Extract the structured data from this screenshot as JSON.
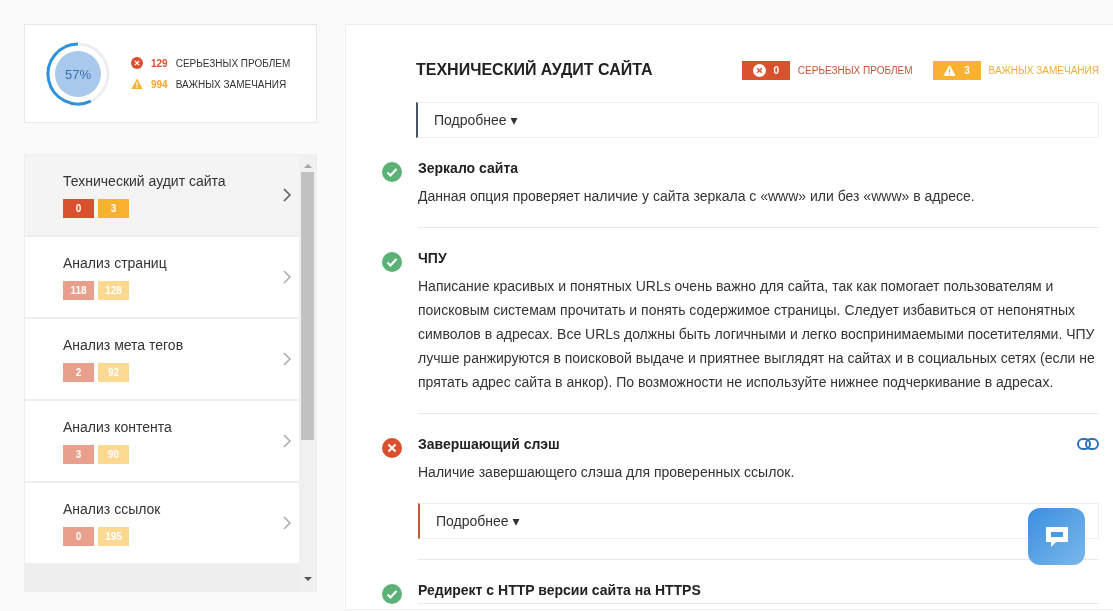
{
  "summary": {
    "score": "57%",
    "level": 0.57,
    "errors": {
      "count": "129",
      "label": "СЕРЬЕЗНЫХ ПРОБЛЕМ"
    },
    "warnings": {
      "count": "994",
      "label": "ВАЖНЫХ ЗАМЕЧАНИЯ"
    }
  },
  "sidebar": {
    "items": [
      {
        "title": "Технический аудит сайта",
        "errors": "0",
        "warnings": "3",
        "selected": true
      },
      {
        "title": "Анализ страниц",
        "errors": "118",
        "warnings": "128",
        "selected": false
      },
      {
        "title": "Анализ мета тегов",
        "errors": "2",
        "warnings": "92",
        "selected": false
      },
      {
        "title": "Анализ контента",
        "errors": "3",
        "warnings": "90",
        "selected": false
      },
      {
        "title": "Анализ ссылок",
        "errors": "0",
        "warnings": "195",
        "selected": false
      }
    ]
  },
  "main": {
    "title": "ТЕХНИЧЕСКИЙ АУДИТ САЙТА",
    "errors": {
      "count": "0",
      "label": "СЕРЬЕЗНЫХ ПРОБЛЕМ"
    },
    "warnings": {
      "count": "3",
      "label": "ВАЖНЫХ ЗАМЕЧАНИЯ"
    },
    "details": {
      "label": "Подробнее ▾"
    },
    "checks": [
      {
        "kind": "ok",
        "title": "Зеркало сайта",
        "text": "Данная опция проверяет наличие у сайта зеркала с «www» или без «www» в адресе."
      },
      {
        "kind": "ok",
        "title": "ЧПУ",
        "text": "Написание красивых и понятных URLs очень важно для сайта, так как помогает пользователям и поисковым системам прочитать и понять содержимое страницы. Следует избавиться от непонятных символов в адресах. Все URLs должны быть логичными и легко воспринимаемыми посетителями. ЧПУ лучше ранжируются в поисковой выдаче и приятнее выглядят на сайтах и в социальных сетях (если не прятать адрес сайта в анкор). По возможности не используйте нижнее подчеркивание в адресах."
      },
      {
        "kind": "error",
        "title": "Завершающий слэш",
        "text": "Наличие завершающего слэша для проверенных ссылок.",
        "link": true,
        "details": "Подробнее ▾"
      },
      {
        "kind": "ok",
        "title": "Редирект с HTTP версии сайта на HTTPS"
      }
    ]
  }
}
